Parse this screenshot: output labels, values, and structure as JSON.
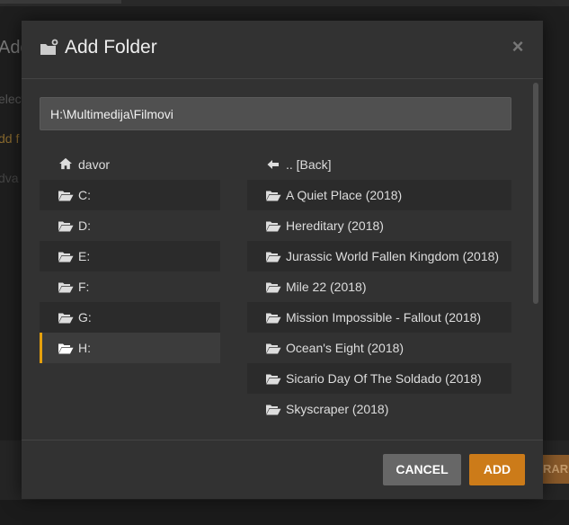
{
  "background": {
    "title_partial": "Add",
    "select_partial": "elect",
    "add_partial": "dd f",
    "adv_partial": "dva",
    "button_partial": "RAR"
  },
  "modal": {
    "title": "Add Folder",
    "close_glyph": "×",
    "path_value": "H:\\Multimedija\\Filmovi",
    "path_placeholder": ""
  },
  "drives": [
    {
      "label": "davor",
      "icon": "home-icon"
    },
    {
      "label": "C:",
      "icon": "folder-open-icon"
    },
    {
      "label": "D:",
      "icon": "folder-open-icon"
    },
    {
      "label": "E:",
      "icon": "folder-open-icon"
    },
    {
      "label": "F:",
      "icon": "folder-open-icon"
    },
    {
      "label": "G:",
      "icon": "folder-open-icon"
    },
    {
      "label": "H:",
      "icon": "folder-open-icon",
      "selected": true
    }
  ],
  "folders": [
    {
      "label": ".. [Back]",
      "icon": "arrow-left-icon"
    },
    {
      "label": "A Quiet Place (2018)",
      "icon": "folder-open-icon"
    },
    {
      "label": "Hereditary (2018)",
      "icon": "folder-open-icon"
    },
    {
      "label": "Jurassic World Fallen Kingdom (2018)",
      "icon": "folder-open-icon"
    },
    {
      "label": "Mile 22 (2018)",
      "icon": "folder-open-icon"
    },
    {
      "label": "Mission Impossible - Fallout (2018)",
      "icon": "folder-open-icon"
    },
    {
      "label": "Ocean's Eight (2018)",
      "icon": "folder-open-icon"
    },
    {
      "label": "Sicario Day Of The Soldado (2018)",
      "icon": "folder-open-icon"
    },
    {
      "label": "Skyscraper (2018)",
      "icon": "folder-open-icon"
    }
  ],
  "buttons": {
    "cancel": "CANCEL",
    "add": "ADD"
  },
  "colors": {
    "accent": "#e5a00d",
    "add_button": "#cc7b19",
    "cancel_button": "#676767",
    "modal_bg": "#323232"
  }
}
